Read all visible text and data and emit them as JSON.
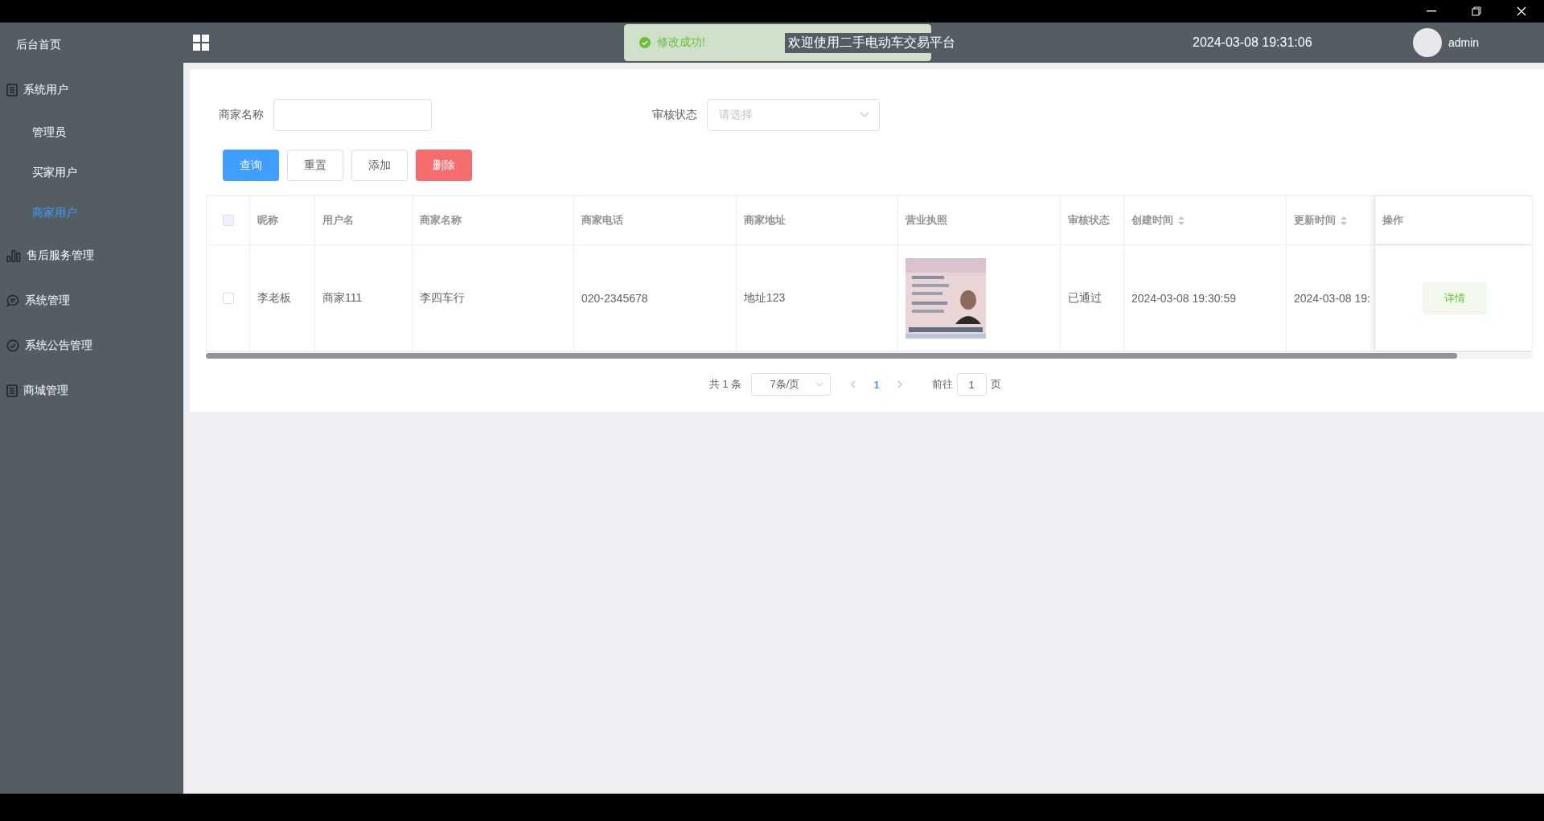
{
  "sidebar": {
    "items": [
      {
        "kind": "link",
        "label": "后台首页",
        "selected": false
      },
      {
        "kind": "group",
        "label": "系统用户",
        "selected": false,
        "children": [
          {
            "label": "管理员",
            "selected": false
          },
          {
            "label": "买家用户",
            "selected": false
          },
          {
            "label": "商家用户",
            "selected": true
          }
        ]
      },
      {
        "kind": "group",
        "label": "售后服务管理",
        "selected": false
      },
      {
        "kind": "group",
        "label": "系统管理",
        "selected": false
      },
      {
        "kind": "group",
        "label": "系统公告管理",
        "selected": false
      },
      {
        "kind": "group",
        "label": "商城管理",
        "selected": false
      }
    ]
  },
  "header": {
    "welcome": "欢迎使用二手电动车交易平台",
    "datetime": "2024-03-08 19:31:06",
    "user": "admin"
  },
  "toast": {
    "message": "修改成功!"
  },
  "filters": [
    {
      "kind": "input",
      "label": "商家名称"
    },
    {
      "kind": "select",
      "label": "审核状态",
      "placeholder": "请选择"
    }
  ],
  "buttons": [
    {
      "kind": "primary",
      "label": "查询"
    },
    {
      "kind": "default",
      "label": "重置"
    },
    {
      "kind": "default",
      "label": "添加"
    },
    {
      "kind": "danger",
      "label": "删除"
    }
  ],
  "table": {
    "columns": [
      {
        "kind": "checkbox",
        "checked": false
      },
      {
        "kind": "text",
        "label": "昵称"
      },
      {
        "kind": "text",
        "label": "用户名"
      },
      {
        "kind": "text",
        "label": "商家名称"
      },
      {
        "kind": "text",
        "label": "商家电话"
      },
      {
        "kind": "text",
        "label": "商家地址"
      },
      {
        "kind": "text",
        "label": "营业执照"
      },
      {
        "kind": "text",
        "label": "审核状态"
      },
      {
        "kind": "sort",
        "label": "创建时间"
      },
      {
        "kind": "sort",
        "label": "更新时间"
      },
      {
        "kind": "text",
        "label": "操作"
      }
    ],
    "rows": [
      {
        "cells": [
          {
            "kind": "checkbox",
            "checked": false
          },
          {
            "kind": "text",
            "text": "李老板"
          },
          {
            "kind": "text",
            "text": "商家111"
          },
          {
            "kind": "text",
            "text": "李四车行"
          },
          {
            "kind": "text",
            "text": "020-2345678"
          },
          {
            "kind": "text",
            "text": "地址123"
          },
          {
            "kind": "picture"
          },
          {
            "kind": "text",
            "text": "已通过"
          },
          {
            "kind": "text",
            "text": "2024-03-08 19:30:59"
          },
          {
            "kind": "text",
            "text": "2024-03-08 19:"
          },
          {
            "kind": "button",
            "text": "详情"
          }
        ]
      }
    ]
  },
  "pagination": {
    "total": "共 1 条",
    "page_size": "7条/页",
    "pages": [
      {
        "label": "1",
        "selected": true
      }
    ],
    "goto_label": "前往",
    "goto_value": "1",
    "goto_suffix": "页"
  }
}
